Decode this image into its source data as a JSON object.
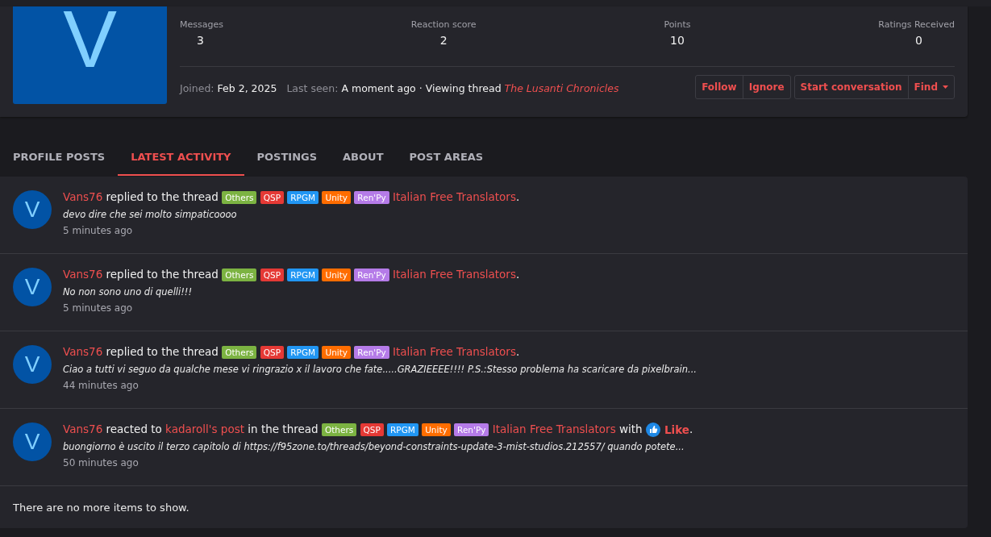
{
  "profile": {
    "avatar_letter": "V",
    "stats": [
      {
        "label": "Messages",
        "value": "3"
      },
      {
        "label": "Reaction score",
        "value": "2"
      },
      {
        "label": "Points",
        "value": "10"
      },
      {
        "label": "Ratings Received",
        "value": "0"
      }
    ],
    "joined_label": "Joined:",
    "joined": "Feb 2, 2025",
    "last_seen_label": "Last seen:",
    "last_seen": "A moment ago · Viewing thread",
    "thread_link": "The Lusanti Chronicles",
    "button_groups": [
      [
        {
          "label": "Follow"
        },
        {
          "label": "Ignore"
        }
      ],
      [
        {
          "label": "Start conversation"
        },
        {
          "label": "Find",
          "dropdown": true
        }
      ]
    ]
  },
  "tabs": [
    {
      "label": "PROFILE POSTS",
      "selected": false
    },
    {
      "label": "LATEST ACTIVITY",
      "selected": true
    },
    {
      "label": "POSTINGS",
      "selected": false
    },
    {
      "label": "ABOUT",
      "selected": false
    },
    {
      "label": "POST AREAS",
      "selected": false
    }
  ],
  "activity": [
    {
      "avatar_letter": "V",
      "parts": [
        {
          "kind": "link",
          "text": "Vans76"
        },
        {
          "kind": "text",
          "text": "replied to the thread"
        },
        {
          "kind": "tag",
          "text": "Others",
          "color": "#7cb342"
        },
        {
          "kind": "tag",
          "text": "QSP",
          "color": "#e53935"
        },
        {
          "kind": "tag",
          "text": "RPGM",
          "color": "#2196f3"
        },
        {
          "kind": "tag",
          "text": "Unity",
          "color": "#ff6d00"
        },
        {
          "kind": "tag",
          "text": "Ren'Py",
          "color": "#b57be8"
        },
        {
          "kind": "link",
          "text": "Italian Free Translators"
        },
        {
          "kind": "punct",
          "text": "."
        }
      ],
      "snippet": "devo dire che sei molto simpaticoooo",
      "time": "5 minutes ago"
    },
    {
      "avatar_letter": "V",
      "parts": [
        {
          "kind": "link",
          "text": "Vans76"
        },
        {
          "kind": "text",
          "text": "replied to the thread"
        },
        {
          "kind": "tag",
          "text": "Others",
          "color": "#7cb342"
        },
        {
          "kind": "tag",
          "text": "QSP",
          "color": "#e53935"
        },
        {
          "kind": "tag",
          "text": "RPGM",
          "color": "#2196f3"
        },
        {
          "kind": "tag",
          "text": "Unity",
          "color": "#ff6d00"
        },
        {
          "kind": "tag",
          "text": "Ren'Py",
          "color": "#b57be8"
        },
        {
          "kind": "link",
          "text": "Italian Free Translators"
        },
        {
          "kind": "punct",
          "text": "."
        }
      ],
      "snippet": "No non sono uno di quelli!!!",
      "time": "5 minutes ago"
    },
    {
      "avatar_letter": "V",
      "parts": [
        {
          "kind": "link",
          "text": "Vans76"
        },
        {
          "kind": "text",
          "text": "replied to the thread"
        },
        {
          "kind": "tag",
          "text": "Others",
          "color": "#7cb342"
        },
        {
          "kind": "tag",
          "text": "QSP",
          "color": "#e53935"
        },
        {
          "kind": "tag",
          "text": "RPGM",
          "color": "#2196f3"
        },
        {
          "kind": "tag",
          "text": "Unity",
          "color": "#ff6d00"
        },
        {
          "kind": "tag",
          "text": "Ren'Py",
          "color": "#b57be8"
        },
        {
          "kind": "link",
          "text": "Italian Free Translators"
        },
        {
          "kind": "punct",
          "text": "."
        }
      ],
      "snippet": "Ciao a tutti vi seguo da qualche mese vi ringrazio x il lavoro che fate.....GRAZIEEEE!!!! P.S.:Stesso problema ha scaricare da pixelbrain...",
      "time": "44 minutes ago"
    },
    {
      "avatar_letter": "V",
      "parts": [
        {
          "kind": "link",
          "text": "Vans76"
        },
        {
          "kind": "text",
          "text": "reacted to"
        },
        {
          "kind": "link",
          "text": "kadaroll's post"
        },
        {
          "kind": "text",
          "text": "in the thread"
        },
        {
          "kind": "tag",
          "text": "Others",
          "color": "#7cb342"
        },
        {
          "kind": "tag",
          "text": "QSP",
          "color": "#e53935"
        },
        {
          "kind": "tag",
          "text": "RPGM",
          "color": "#2196f3"
        },
        {
          "kind": "tag",
          "text": "Unity",
          "color": "#ff6d00"
        },
        {
          "kind": "tag",
          "text": "Ren'Py",
          "color": "#b57be8"
        },
        {
          "kind": "link",
          "text": "Italian Free Translators"
        },
        {
          "kind": "text",
          "text": "with"
        },
        {
          "kind": "reaction",
          "text": "Like"
        },
        {
          "kind": "punct",
          "text": "."
        }
      ],
      "snippet": "buongiorno è uscito il terzo capitolo di https://f95zone.to/threads/beyond-constraints-update-3-mist-studios.212557/ quando potete...",
      "time": "50 minutes ago"
    }
  ],
  "end_message": "There are no more items to show."
}
